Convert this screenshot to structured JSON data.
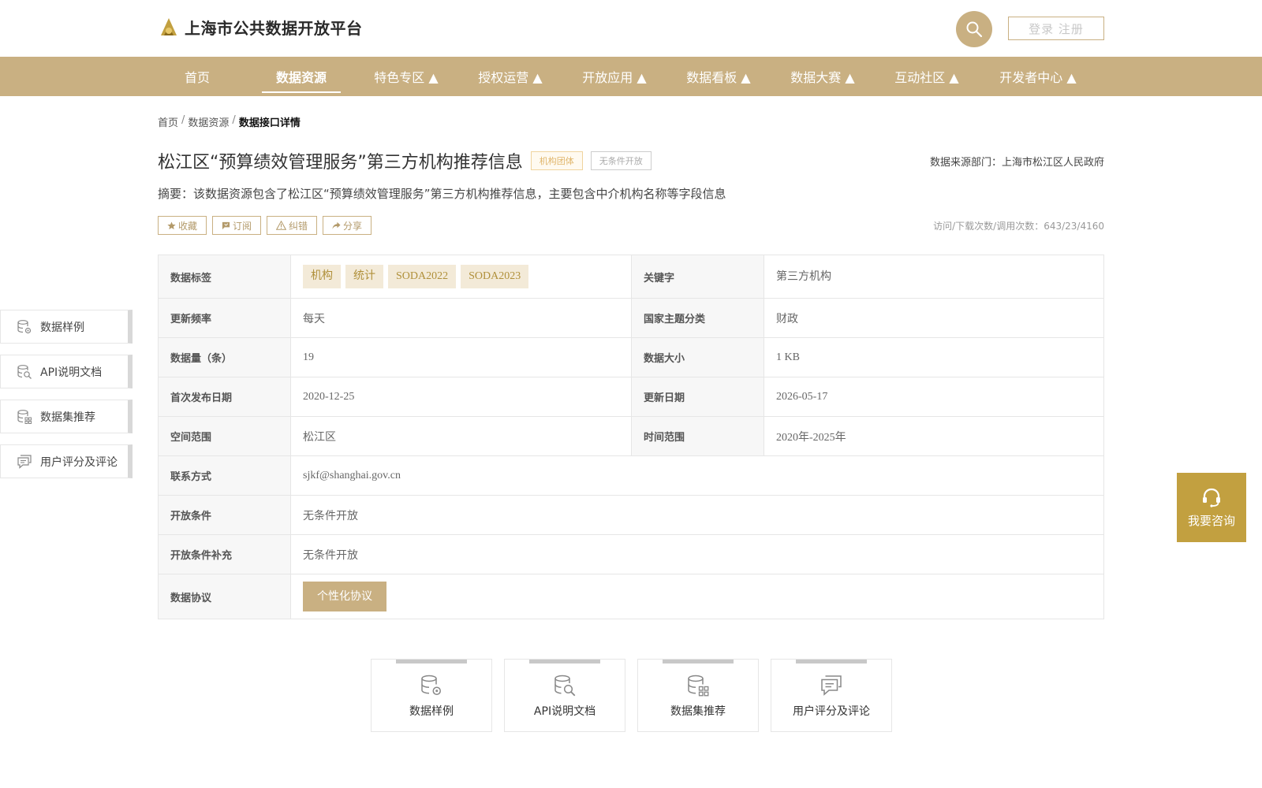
{
  "header": {
    "site_title": "上海市公共数据开放平台",
    "login_label": "登录 注册"
  },
  "nav": {
    "items": [
      {
        "label": "首页"
      },
      {
        "label": "数据资源"
      },
      {
        "label": "特色专区 ▲"
      },
      {
        "label": "授权运营 ▲"
      },
      {
        "label": "开放应用 ▲"
      },
      {
        "label": "数据看板 ▲"
      },
      {
        "label": "数据大赛 ▲"
      },
      {
        "label": "互动社区 ▲"
      },
      {
        "label": "开发者中心 ▲"
      }
    ],
    "active_index": 1
  },
  "breadcrumb": {
    "home": "首页",
    "sep": "/",
    "section": "数据资源",
    "current": "数据接口详情"
  },
  "dataset": {
    "title": "松江区“预算绩效管理服务”第三方机构推荐信息",
    "badge_org": "机构团体",
    "badge_open": "无条件开放",
    "source": "数据来源部门：上海市松江区人民政府",
    "summary": "摘要：该数据资源包含了松江区“预算绩效管理服务”第三方机构推荐信息，主要包含中介机构名称等字段信息",
    "stats": "访问/下载次数/调用次数：643/23/4160"
  },
  "actions": {
    "favorite": "收藏",
    "subscribe": "订阅",
    "report": "纠错",
    "share": "分享"
  },
  "info": {
    "tags_label": "数据标签",
    "tags": [
      "机构",
      "统计",
      "SODA2022",
      "SODA2023"
    ],
    "keyword_label": "关键字",
    "keyword": "第三方机构",
    "freq_label": "更新频率",
    "freq": "每天",
    "theme_label": "国家主题分类",
    "theme": "财政",
    "count_label": "数据量（条）",
    "count": "19",
    "size_label": "数据大小",
    "size": "1 KB",
    "first_pub_label": "首次发布日期",
    "first_pub": "2020-12-25",
    "updated_label": "更新日期",
    "updated": "2026-05-17",
    "space_label": "空间范围",
    "space": "松江区",
    "time_label": "时间范围",
    "time": "2020年-2025年",
    "contact_label": "联系方式",
    "contact": "sjkf@shanghai.gov.cn",
    "open_cond_label": "开放条件",
    "open_cond": "无条件开放",
    "open_extra_label": "开放条件补充",
    "open_extra": "无条件开放",
    "protocol_label": "数据协议",
    "protocol_btn": "个性化协议"
  },
  "side_nav": [
    {
      "label": "数据样例",
      "icon": "database-gear-icon"
    },
    {
      "label": "API说明文档",
      "icon": "database-search-icon"
    },
    {
      "label": "数据集推荐",
      "icon": "database-grid-icon"
    },
    {
      "label": "用户评分及评论",
      "icon": "comment-icon"
    }
  ],
  "consult": {
    "label": "我要咨询",
    "icon": "headset-icon"
  },
  "cards": [
    {
      "label": "数据样例",
      "icon": "database-gear-icon"
    },
    {
      "label": "API说明文档",
      "icon": "database-search-icon"
    },
    {
      "label": "数据集推荐",
      "icon": "database-grid-icon"
    },
    {
      "label": "用户评分及评论",
      "icon": "comment-icon"
    }
  ],
  "colors": {
    "accent": "#c9b082",
    "consult": "#c2a040"
  }
}
